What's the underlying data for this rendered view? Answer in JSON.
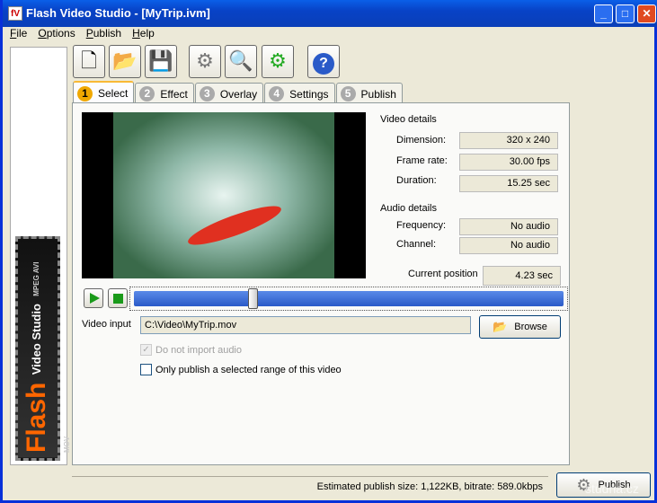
{
  "window": {
    "title": "Flash Video Studio - [MyTrip.ivm]",
    "app_icon": "fV"
  },
  "menu": [
    "File",
    "Options",
    "Publish",
    "Help"
  ],
  "sidebar": {
    "logo_title": "Flash",
    "logo_sub": "Video Studio",
    "formats": "MPEG AVI MOV"
  },
  "toolbar": [
    {
      "name": "new",
      "icon": "new-file-icon"
    },
    {
      "name": "open",
      "icon": "open-folder-icon"
    },
    {
      "name": "save",
      "icon": "save-disk-icon"
    },
    {
      "name": "settings",
      "icon": "gears-icon"
    },
    {
      "name": "preview",
      "icon": "magnifier-icon"
    },
    {
      "name": "publish",
      "icon": "gears-play-icon"
    },
    {
      "name": "help",
      "icon": "help-icon"
    }
  ],
  "tabs": [
    {
      "num": "1",
      "label": "Select"
    },
    {
      "num": "2",
      "label": "Effect"
    },
    {
      "num": "3",
      "label": "Overlay"
    },
    {
      "num": "4",
      "label": "Settings"
    },
    {
      "num": "5",
      "label": "Publish"
    }
  ],
  "video_details": {
    "heading": "Video details",
    "dimension_label": "Dimension:",
    "dimension": "320 x 240",
    "framerate_label": "Frame rate:",
    "framerate": "30.00 fps",
    "duration_label": "Duration:",
    "duration": "15.25 sec"
  },
  "audio_details": {
    "heading": "Audio details",
    "frequency_label": "Frequency:",
    "frequency": "No audio",
    "channel_label": "Channel:",
    "channel": "No audio"
  },
  "position": {
    "label": "Current position",
    "value": "4.23 sec",
    "fraction": 0.277
  },
  "input": {
    "label": "Video input",
    "value": "C:\\Video\\MyTrip.mov",
    "browse": "Browse"
  },
  "options": {
    "no_audio": "Do not import audio",
    "range": "Only publish a selected range of this video"
  },
  "status": "Estimated publish size: 1,122KB, bitrate: 589.0kbps",
  "publish_button": "Publish",
  "watermark": "studna.cz"
}
